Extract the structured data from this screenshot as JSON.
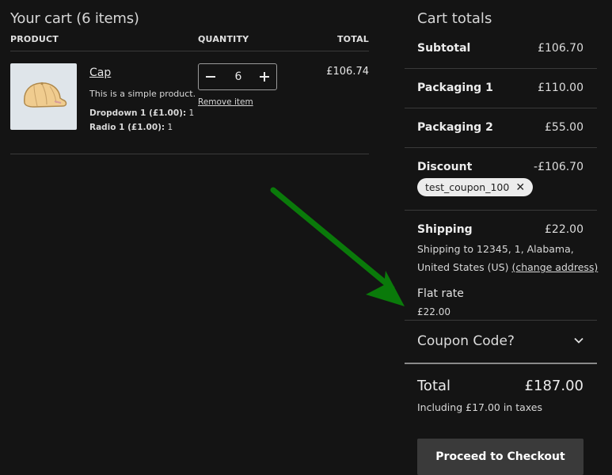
{
  "cart": {
    "heading": "Your cart (6 items)",
    "columns": {
      "product": "PRODUCT",
      "quantity": "QUANTITY",
      "total": "TOTAL"
    },
    "items": [
      {
        "name": "Cap",
        "description": "This is a simple product.",
        "meta": [
          {
            "label": "Dropdown 1 (£1.00):",
            "value": "1"
          },
          {
            "label": "Radio 1 (£1.00):",
            "value": "1"
          }
        ],
        "quantity": "6",
        "remove_label": "Remove item",
        "line_total": "£106.74"
      }
    ]
  },
  "totals": {
    "title": "Cart totals",
    "subtotal": {
      "label": "Subtotal",
      "value": "£106.70"
    },
    "packaging1": {
      "label": "Packaging 1",
      "value": "£110.00"
    },
    "packaging2": {
      "label": "Packaging 2",
      "value": "£55.00"
    },
    "discount": {
      "label": "Discount",
      "value": "-£106.70",
      "coupon": "test_coupon_100"
    },
    "shipping": {
      "label": "Shipping",
      "value": "£22.00",
      "address_line1": "Shipping to 12345, 1, Alabama,",
      "address_line2": "United States (US)",
      "change_link": "(change address)",
      "method": "Flat rate",
      "method_price": "£22.00"
    },
    "coupon_toggle": "Coupon Code?",
    "total": {
      "label": "Total",
      "value": "£187.00",
      "tax_note": "Including £17.00 in taxes"
    },
    "checkout_label": "Proceed to Checkout"
  },
  "colors": {
    "background": "#141414",
    "text": "#e8e8e8",
    "divider": "#3a3a3a",
    "annotation_arrow": "#0a7a0a"
  }
}
